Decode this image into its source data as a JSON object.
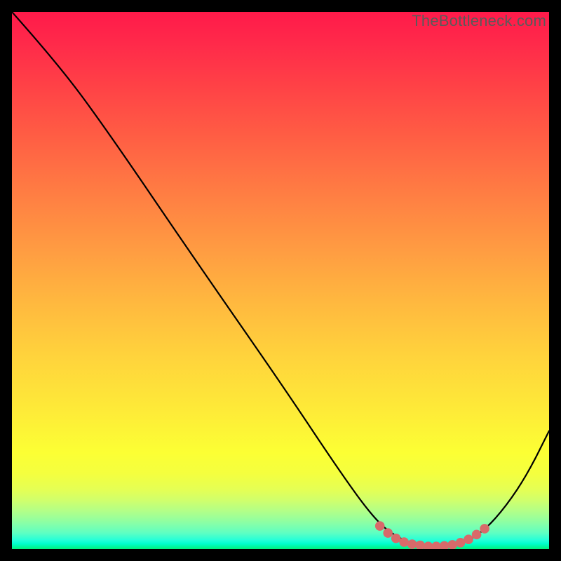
{
  "attribution": "TheBottleneck.com",
  "chart_data": {
    "type": "line",
    "title": "",
    "xlabel": "",
    "ylabel": "",
    "xlim": [
      0,
      100
    ],
    "ylim": [
      0,
      100
    ],
    "grid": false,
    "legend": false,
    "series": [
      {
        "name": "bottleneck-curve",
        "color": "#000000",
        "points": [
          {
            "x": 0,
            "y": 100
          },
          {
            "x": 8,
            "y": 91
          },
          {
            "x": 17,
            "y": 79
          },
          {
            "x": 34,
            "y": 54
          },
          {
            "x": 50,
            "y": 31
          },
          {
            "x": 62,
            "y": 13
          },
          {
            "x": 68,
            "y": 5
          },
          {
            "x": 72,
            "y": 2
          },
          {
            "x": 76,
            "y": 0.6
          },
          {
            "x": 80,
            "y": 0.5
          },
          {
            "x": 84,
            "y": 1
          },
          {
            "x": 88,
            "y": 3.5
          },
          {
            "x": 92,
            "y": 8
          },
          {
            "x": 96,
            "y": 14
          },
          {
            "x": 100,
            "y": 22
          }
        ]
      },
      {
        "name": "highlight-dots",
        "color": "#d86a6a",
        "points": [
          {
            "x": 68.5,
            "y": 4.3
          },
          {
            "x": 70.0,
            "y": 3.0
          },
          {
            "x": 71.5,
            "y": 2.0
          },
          {
            "x": 73.0,
            "y": 1.3
          },
          {
            "x": 74.5,
            "y": 0.9
          },
          {
            "x": 76.0,
            "y": 0.7
          },
          {
            "x": 77.5,
            "y": 0.5
          },
          {
            "x": 79.0,
            "y": 0.5
          },
          {
            "x": 80.5,
            "y": 0.6
          },
          {
            "x": 82.0,
            "y": 0.8
          },
          {
            "x": 83.5,
            "y": 1.2
          },
          {
            "x": 85.0,
            "y": 1.8
          },
          {
            "x": 86.5,
            "y": 2.7
          },
          {
            "x": 88.0,
            "y": 3.8
          }
        ]
      }
    ]
  }
}
